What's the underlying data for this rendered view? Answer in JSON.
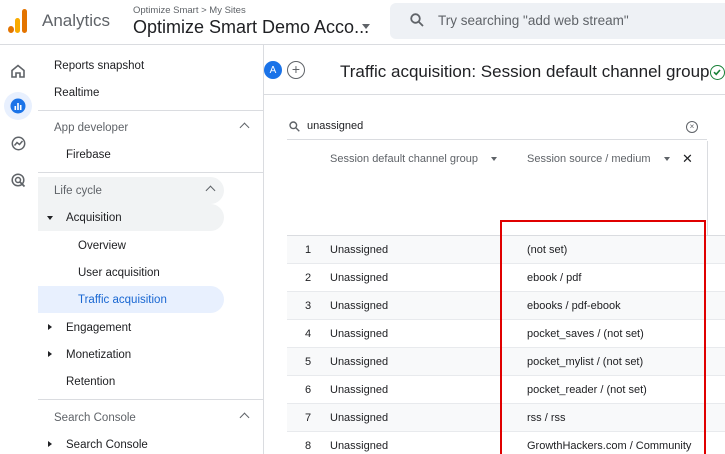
{
  "app": {
    "title": "Analytics"
  },
  "account": {
    "breadcrumb": "Optimize Smart > My Sites",
    "name": "Optimize Smart Demo Acco..."
  },
  "search": {
    "placeholder": "Try searching \"add web stream\""
  },
  "sidebar": {
    "items": [
      {
        "label": "Reports snapshot"
      },
      {
        "label": "Realtime"
      },
      {
        "label": "App developer"
      },
      {
        "label": "Firebase"
      },
      {
        "label": "Life cycle"
      },
      {
        "label": "Acquisition"
      },
      {
        "label": "Overview"
      },
      {
        "label": "User acquisition"
      },
      {
        "label": "Traffic acquisition"
      },
      {
        "label": "Engagement"
      },
      {
        "label": "Monetization"
      },
      {
        "label": "Retention"
      },
      {
        "label": "Search Console"
      },
      {
        "label": "Search Console"
      }
    ]
  },
  "header": {
    "avatar": "A",
    "add_comparison": "+",
    "title": "Traffic acquisition: Session default channel group"
  },
  "table": {
    "search_value": "unassigned",
    "columns": [
      "Session default channel group",
      "Session source / medium"
    ],
    "rows": [
      {
        "num": "1",
        "channel": "Unassigned",
        "source": "(not set)"
      },
      {
        "num": "2",
        "channel": "Unassigned",
        "source": "ebook / pdf"
      },
      {
        "num": "3",
        "channel": "Unassigned",
        "source": "ebooks / pdf-ebook"
      },
      {
        "num": "4",
        "channel": "Unassigned",
        "source": "pocket_saves / (not set)"
      },
      {
        "num": "5",
        "channel": "Unassigned",
        "source": "pocket_mylist / (not set)"
      },
      {
        "num": "6",
        "channel": "Unassigned",
        "source": "pocket_reader / (not set)"
      },
      {
        "num": "7",
        "channel": "Unassigned",
        "source": "rss / rss"
      },
      {
        "num": "8",
        "channel": "Unassigned",
        "source": "GrowthHackers.com / Community"
      }
    ]
  },
  "colors": {
    "accent": "#1a73e8",
    "highlight": "#e00000",
    "active_nav": "#e8f0fe"
  }
}
